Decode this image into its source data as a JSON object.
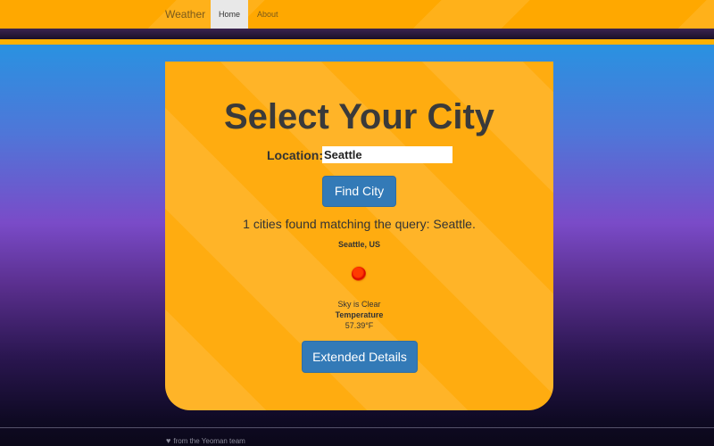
{
  "navbar": {
    "brand": "Weather",
    "tabs": [
      {
        "label": "Home",
        "active": true
      },
      {
        "label": "About",
        "active": false
      }
    ]
  },
  "main": {
    "title": "Select Your City",
    "location_label": "Location:",
    "location_value": "Seattle",
    "find_button": "Find City",
    "result_message": "1 cities found matching the query: Seattle.",
    "city": "Seattle, US",
    "weather_icon": "clear-sky-sun-icon",
    "description": "Sky is Clear",
    "temperature_label": "Temperature",
    "temperature_value": "57.39°F",
    "details_button": "Extended Details"
  },
  "footer": {
    "icon": "heart-icon",
    "text": "from the Yeoman team"
  },
  "colors": {
    "accent": "#ffac10",
    "button": "#337ab7"
  }
}
